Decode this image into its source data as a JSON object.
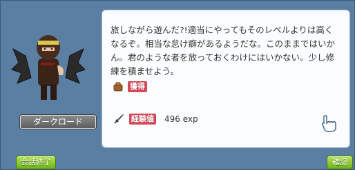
{
  "npc": {
    "name": "ダークロード"
  },
  "dialog": {
    "text": "旅しながら遊んだ?!適当にやってもそのレベルよりは高くなるぞ。相当な怠け癖があるようだな。このままではいかん。君のような者を放っておくわけにはいかない。少し修練を積ませよう。"
  },
  "rewards": {
    "obtain_label": "獲得",
    "exp_label": "経験値",
    "exp_value": "496 exp"
  },
  "buttons": {
    "end_chat": "会話終了",
    "confirm": "確認"
  },
  "colors": {
    "frame": "#5a7fa3",
    "button_green": "#6fb21a",
    "reward_label_red": "#d34a5a"
  },
  "icons": {
    "bag": "bag-icon",
    "sword": "sword-icon",
    "cursor": "pointing-hand-cursor-icon"
  }
}
